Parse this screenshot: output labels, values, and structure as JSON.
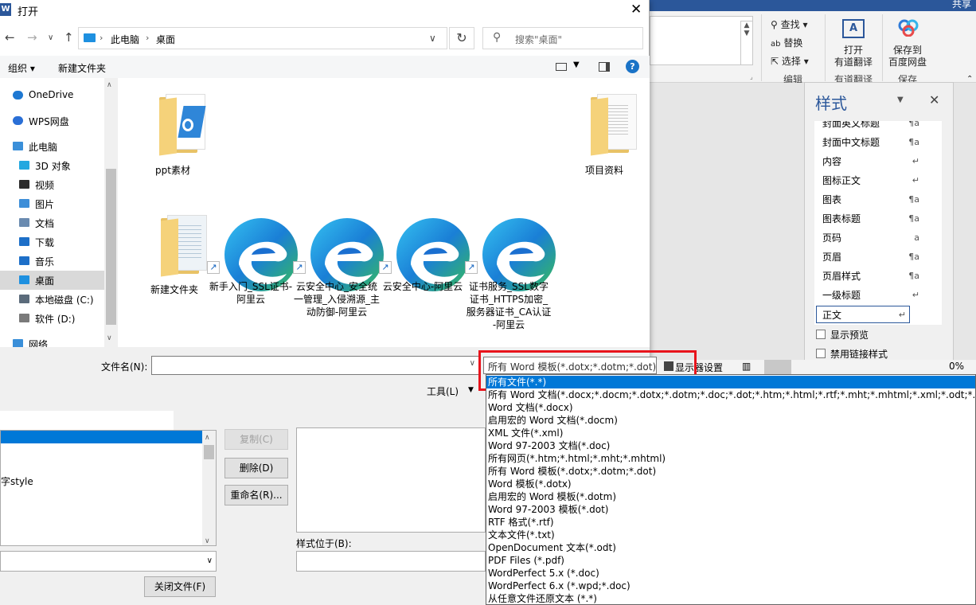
{
  "word": {
    "share_label": "共享",
    "ribbon": {
      "find": "查找",
      "replace": "替换",
      "select": "选择",
      "editing_group": "编辑",
      "youdao_btn": "打开\n有道翻译",
      "youdao_open": "打开",
      "youdao_name": "有道翻译",
      "youdao_group": "有道翻译",
      "baidu_line1": "保存到",
      "baidu_line2": "百度网盘",
      "save_group": "保存"
    },
    "styles_pane": {
      "title": "样式",
      "items": [
        {
          "label": "封面英文标题",
          "mark": "¶a"
        },
        {
          "label": "封面中文标题",
          "mark": "¶a"
        },
        {
          "label": "内容",
          "mark": "↵"
        },
        {
          "label": "图标正文",
          "mark": "↵"
        },
        {
          "label": "图表",
          "mark": "¶a"
        },
        {
          "label": "图表标题",
          "mark": "¶a"
        },
        {
          "label": "页码",
          "mark": "a"
        },
        {
          "label": "页眉",
          "mark": "¶a"
        },
        {
          "label": "页眉样式",
          "mark": "¶a"
        },
        {
          "label": "一级标题",
          "mark": "↵"
        },
        {
          "label": "正文",
          "mark": "↵"
        }
      ],
      "show_preview": "显示预览",
      "disable_linked": "禁用链接样式"
    },
    "status": {
      "display_settings": "显示器设置",
      "zoom_suffix": "0%"
    }
  },
  "open_dialog": {
    "title": "打开",
    "breadcrumb": [
      "此电脑",
      "桌面"
    ],
    "search_placeholder": "搜索\"桌面\"",
    "toolbar": {
      "organize": "组织 ▾",
      "new_folder": "新建文件夹"
    },
    "nav_items": [
      {
        "label": "OneDrive",
        "icon": "cloud-icon",
        "color": "#1e78d2"
      },
      {
        "label": "WPS网盘",
        "icon": "cloud-outline-icon",
        "color": "#2a6fd6"
      },
      {
        "label": "此电脑",
        "icon": "computer-icon",
        "color": "#3a8fd9"
      },
      {
        "label": "3D 对象",
        "icon": "cube-icon",
        "color": "#23a8e0"
      },
      {
        "label": "视频",
        "icon": "film-icon",
        "color": "#2c2c2c"
      },
      {
        "label": "图片",
        "icon": "picture-icon",
        "color": "#3d8ed8"
      },
      {
        "label": "文档",
        "icon": "document-icon",
        "color": "#6a8bb0"
      },
      {
        "label": "下载",
        "icon": "download-icon",
        "color": "#1d6fc8"
      },
      {
        "label": "音乐",
        "icon": "music-icon",
        "color": "#1d6fc8"
      },
      {
        "label": "桌面",
        "icon": "desktop-icon",
        "color": "#1e90e0"
      },
      {
        "label": "本地磁盘 (C:)",
        "icon": "drive-c-icon",
        "color": "#5b6b7b"
      },
      {
        "label": "软件 (D:)",
        "icon": "drive-icon",
        "color": "#7a7a7a"
      },
      {
        "label": "网络",
        "icon": "network-icon",
        "color": "#3a8fd9"
      }
    ],
    "files": [
      {
        "name": "ppt素材",
        "type": "folder"
      },
      {
        "name": "项目资料",
        "type": "folder"
      },
      {
        "name": "新建文件夹",
        "type": "folder"
      },
      {
        "name": "新手入门_SSL证书-阿里云",
        "type": "edge-shortcut"
      },
      {
        "name": "云安全中心_安全统一管理_入侵溯源_主动防御-阿里云",
        "type": "edge-shortcut"
      },
      {
        "name": "云安全中心-阿里云",
        "type": "edge-shortcut"
      },
      {
        "name": "证书服务_SSL数字证书_HTTPS加密_服务器证书_CA认证 -阿里云",
        "type": "edge-shortcut"
      }
    ],
    "filename_label": "文件名(N):",
    "filename_value": "",
    "tools_label": "工具(L)",
    "filetype_selected": "所有 Word 模板(*.dotx;*.dotm;*.dot)"
  },
  "filetype_options": [
    "所有文件(*.*)",
    "所有 Word 文档(*.docx;*.docm;*.dotx;*.dotm;*.doc;*.dot;*.htm;*.html;*.rtf;*.mht;*.mhtml;*.xml;*.odt;*.pdf)",
    "Word 文档(*.docx)",
    "启用宏的 Word 文档(*.docm)",
    "XML 文件(*.xml)",
    "Word 97-2003 文档(*.doc)",
    "所有网页(*.htm;*.html;*.mht;*.mhtml)",
    "所有 Word 模板(*.dotx;*.dotm;*.dot)",
    "Word 模板(*.dotx)",
    "启用宏的 Word 模板(*.dotm)",
    "Word 97-2003 模板(*.dot)",
    "RTF 格式(*.rtf)",
    "文本文件(*.txt)",
    "OpenDocument 文本(*.odt)",
    "PDF Files (*.pdf)",
    "WordPerfect 5.x (*.doc)",
    "WordPerfect 6.x (*.wpd;*.doc)",
    "从任意文件还原文本 (*.*)"
  ],
  "organizer": {
    "list_item": "字style",
    "copy_btn": "复制(C)",
    "delete_btn": "删除(D)",
    "rename_btn": "重命名(R)...",
    "styles_in_label": "样式位于(B):",
    "close_file_btn": "关闭文件(F)"
  },
  "colors": {
    "word_blue": "#2b579a",
    "selection_blue": "#0078d7",
    "highlight_red": "#e8141c"
  }
}
